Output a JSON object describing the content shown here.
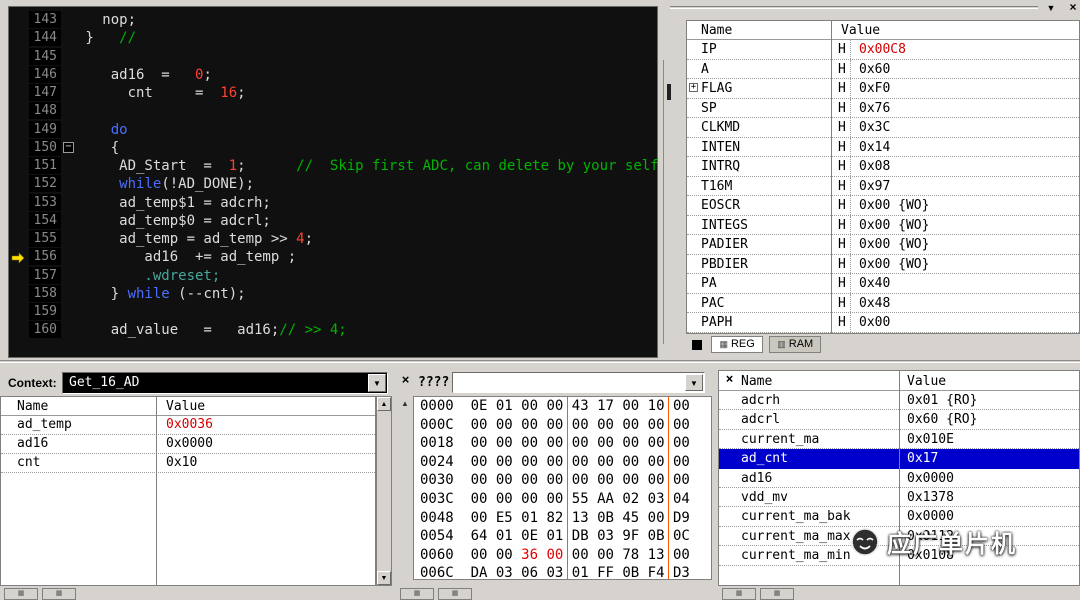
{
  "colors": {
    "selection": "#0000cd",
    "value_red": "#d40000",
    "hex_byte_red": "#e00000",
    "hex_group_separator": "#ff5a00",
    "editor_background": "#101010",
    "editor_plain": "#dcdcdc",
    "editor_keyword": "#4b6eff",
    "editor_number": "#ff4033",
    "editor_comment": "#00b400",
    "editor_special": "#48a79b",
    "execution_arrow": "#ffe000"
  },
  "icons": {
    "close": "×",
    "dropdown": "▼",
    "scroll_up": "▲",
    "scroll_down": "▼",
    "fold": "−",
    "expand": "+",
    "reg_tab": "▦",
    "ram_tab": "▥",
    "stub_tab": "▦"
  },
  "editor": {
    "current_line": "156",
    "fold_line": "150",
    "lines": [
      {
        "num": "143",
        "segs": [
          [
            "w",
            "   nop;"
          ]
        ]
      },
      {
        "num": "144",
        "segs": [
          [
            "w",
            " }   "
          ],
          [
            "c",
            "//"
          ]
        ]
      },
      {
        "num": "145",
        "segs": []
      },
      {
        "num": "146",
        "segs": [
          [
            "w",
            "    ad16  =   "
          ],
          [
            "n",
            "0"
          ],
          [
            "w",
            ";"
          ]
        ]
      },
      {
        "num": "147",
        "segs": [
          [
            "w",
            "      cnt     =  "
          ],
          [
            "n",
            "16"
          ],
          [
            "w",
            ";"
          ]
        ]
      },
      {
        "num": "148",
        "segs": []
      },
      {
        "num": "149",
        "segs": [
          [
            "w",
            "    "
          ],
          [
            "k",
            "do"
          ]
        ]
      },
      {
        "num": "150",
        "segs": [
          [
            "w",
            "    {"
          ]
        ]
      },
      {
        "num": "151",
        "segs": [
          [
            "w",
            "     AD_Start  =  "
          ],
          [
            "n",
            "1"
          ],
          [
            "w",
            ";      "
          ],
          [
            "c",
            "//  Skip first ADC, can delete by your self"
          ]
        ]
      },
      {
        "num": "152",
        "segs": [
          [
            "w",
            "     "
          ],
          [
            "k",
            "while"
          ],
          [
            "w",
            "(!AD_DONE);"
          ]
        ]
      },
      {
        "num": "153",
        "segs": [
          [
            "w",
            "     ad_temp$1 = adcrh;"
          ]
        ]
      },
      {
        "num": "154",
        "segs": [
          [
            "w",
            "     ad_temp$0 = adcrl;"
          ]
        ]
      },
      {
        "num": "155",
        "segs": [
          [
            "w",
            "     ad_temp = ad_temp >> "
          ],
          [
            "n",
            "4"
          ],
          [
            "w",
            ";"
          ]
        ]
      },
      {
        "num": "156",
        "segs": [
          [
            "w",
            "        ad16  += ad_temp ;"
          ]
        ]
      },
      {
        "num": "157",
        "segs": [
          [
            "t",
            "        .wdreset;"
          ]
        ]
      },
      {
        "num": "158",
        "segs": [
          [
            "w",
            "    } "
          ],
          [
            "k",
            "while"
          ],
          [
            "w",
            " (--cnt);"
          ]
        ]
      },
      {
        "num": "159",
        "segs": []
      },
      {
        "num": "160",
        "segs": [
          [
            "w",
            "    ad_value   =   ad16;"
          ],
          [
            "c",
            "// >> 4;"
          ]
        ]
      }
    ]
  },
  "registers": {
    "columns": [
      "Name",
      "Value"
    ],
    "value_prefix": "H",
    "rows": [
      {
        "name": "IP",
        "value": "0x00C8",
        "red": true
      },
      {
        "name": "A",
        "value": "0x60"
      },
      {
        "name": "FLAG",
        "value": "0xF0",
        "expand": true
      },
      {
        "name": "SP",
        "value": "0x76"
      },
      {
        "name": "CLKMD",
        "value": "0x3C"
      },
      {
        "name": "INTEN",
        "value": "0x14"
      },
      {
        "name": "INTRQ",
        "value": "0x08"
      },
      {
        "name": "T16M",
        "value": "0x97"
      },
      {
        "name": "EOSCR",
        "value": "0x00 {WO}"
      },
      {
        "name": "INTEGS",
        "value": "0x00 {WO}"
      },
      {
        "name": "PADIER",
        "value": "0x00 {WO}"
      },
      {
        "name": "PBDIER",
        "value": "0x00 {WO}"
      },
      {
        "name": "PA",
        "value": "0x40"
      },
      {
        "name": "PAC",
        "value": "0x48"
      },
      {
        "name": "PAPH",
        "value": "0x00"
      }
    ],
    "tabs": [
      {
        "label": "REG",
        "active": true
      },
      {
        "label": "RAM",
        "active": false
      }
    ]
  },
  "context_panel": {
    "label": "Context:",
    "selected": "Get_16_AD",
    "columns": [
      "Name",
      "Value"
    ],
    "rows": [
      {
        "name": "ad_temp",
        "value": "0x0036",
        "red": true
      },
      {
        "name": "ad16",
        "value": "0x0000"
      },
      {
        "name": "cnt",
        "value": "0x10"
      }
    ]
  },
  "memory_panel": {
    "title": "????",
    "combo_value": "",
    "rows": [
      {
        "addr": "0000",
        "bytes": [
          "0E",
          "01",
          "00",
          "00",
          "43",
          "17",
          "00",
          "10",
          "00"
        ],
        "red": []
      },
      {
        "addr": "000C",
        "bytes": [
          "00",
          "00",
          "00",
          "00",
          "00",
          "00",
          "00",
          "00",
          "00"
        ],
        "red": []
      },
      {
        "addr": "0018",
        "bytes": [
          "00",
          "00",
          "00",
          "00",
          "00",
          "00",
          "00",
          "00",
          "00"
        ],
        "red": []
      },
      {
        "addr": "0024",
        "bytes": [
          "00",
          "00",
          "00",
          "00",
          "00",
          "00",
          "00",
          "00",
          "00"
        ],
        "red": []
      },
      {
        "addr": "0030",
        "bytes": [
          "00",
          "00",
          "00",
          "00",
          "00",
          "00",
          "00",
          "00",
          "00"
        ],
        "red": []
      },
      {
        "addr": "003C",
        "bytes": [
          "00",
          "00",
          "00",
          "00",
          "55",
          "AA",
          "02",
          "03",
          "04"
        ],
        "red": []
      },
      {
        "addr": "0048",
        "bytes": [
          "00",
          "E5",
          "01",
          "82",
          "13",
          "0B",
          "45",
          "00",
          "D9"
        ],
        "red": []
      },
      {
        "addr": "0054",
        "bytes": [
          "64",
          "01",
          "0E",
          "01",
          "DB",
          "03",
          "9F",
          "0B",
          "0C"
        ],
        "red": []
      },
      {
        "addr": "0060",
        "bytes": [
          "00",
          "00",
          "36",
          "00",
          "00",
          "00",
          "78",
          "13",
          "00"
        ],
        "red": [
          2,
          3
        ]
      },
      {
        "addr": "006C",
        "bytes": [
          "DA",
          "03",
          "06",
          "03",
          "01",
          "FF",
          "0B",
          "F4",
          "D3"
        ],
        "red": []
      }
    ]
  },
  "watch_panel": {
    "columns": [
      "Name",
      "Value"
    ],
    "rows": [
      {
        "name": "adcrh",
        "value": "0x01 {RO}"
      },
      {
        "name": "adcrl",
        "value": "0x60 {RO}"
      },
      {
        "name": "current_ma",
        "value": "0x010E"
      },
      {
        "name": "ad_cnt",
        "value": "0x17",
        "selected": true
      },
      {
        "name": "ad16",
        "value": "0x0000"
      },
      {
        "name": "vdd_mv",
        "value": "0x1378"
      },
      {
        "name": "current_ma_bak",
        "value": "0x0000"
      },
      {
        "name": "current_ma_max",
        "value": "0x0112"
      },
      {
        "name": "current_ma_min",
        "value": "0x0108"
      }
    ]
  },
  "watermark": {
    "text": "应广单片机"
  }
}
